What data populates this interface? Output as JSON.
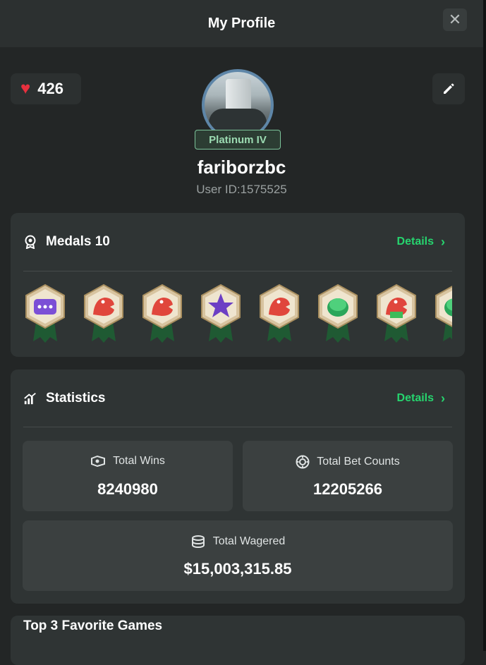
{
  "header": {
    "title": "My Profile",
    "close_icon": "close-icon"
  },
  "profile": {
    "likes": "426",
    "rank": "Platinum IV",
    "username": "fariborzbc",
    "user_id": "User ID:1575525"
  },
  "medals": {
    "title": "Medals 10",
    "details_label": "Details",
    "items": [
      "chat-medal",
      "crocodile-medal",
      "crocodile-medal",
      "star-medal",
      "crocodile-medal",
      "coin-medal",
      "crocodile-money-medal",
      "coin-medal"
    ]
  },
  "statistics": {
    "title": "Statistics",
    "details_label": "Details",
    "total_wins_label": "Total Wins",
    "total_wins": "8240980",
    "bet_counts_label": "Total Bet Counts",
    "bet_counts": "12205266",
    "wagered_label": "Total Wagered",
    "wagered": "$15,003,315.85"
  },
  "favorites": {
    "title": "Top 3 Favorite Games"
  },
  "colors": {
    "accent": "#26d46e",
    "heart": "#e8303e",
    "rank": "#9cdbb2"
  }
}
